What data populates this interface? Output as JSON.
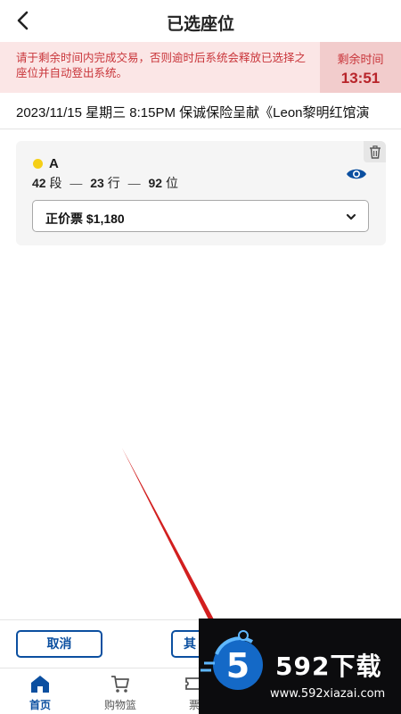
{
  "header": {
    "title": "已选座位",
    "back_icon": "chevron-left-icon"
  },
  "banner": {
    "message": "请于剩余时间内完成交易，否则逾时后系统会释放已选择之座位并自动登出系统。",
    "timer_label": "剩余时间",
    "timer_value": "13:51",
    "colors": {
      "text": "#c9353a",
      "background": "#fbe6e6"
    }
  },
  "event": {
    "line": "2023/11/15 星期三 8:15PM 保诚保险呈献《Leon黎明红馆演"
  },
  "seat": {
    "zone": "A",
    "zone_color": "#f5cf17",
    "section": "42",
    "section_unit": "段",
    "row": "23",
    "row_unit": "行",
    "seat_number": "92",
    "seat_unit": "位",
    "separator": "—",
    "ticket_type": "正价票 $1,180",
    "delete_icon": "trash-icon",
    "view_icon": "eye-icon"
  },
  "actions": {
    "cancel_label": "取消",
    "other_label_partial": "其"
  },
  "tabs": [
    {
      "label": "首页",
      "icon": "home-icon",
      "active": true
    },
    {
      "label": "购物篮",
      "icon": "cart-icon",
      "active": false
    },
    {
      "label": "票",
      "icon": "ticket-icon",
      "active": false
    }
  ],
  "watermark": {
    "brand": "592下载",
    "digit": "5",
    "url": "www.592xiazai.com"
  },
  "accent_color": "#0b4fa0"
}
